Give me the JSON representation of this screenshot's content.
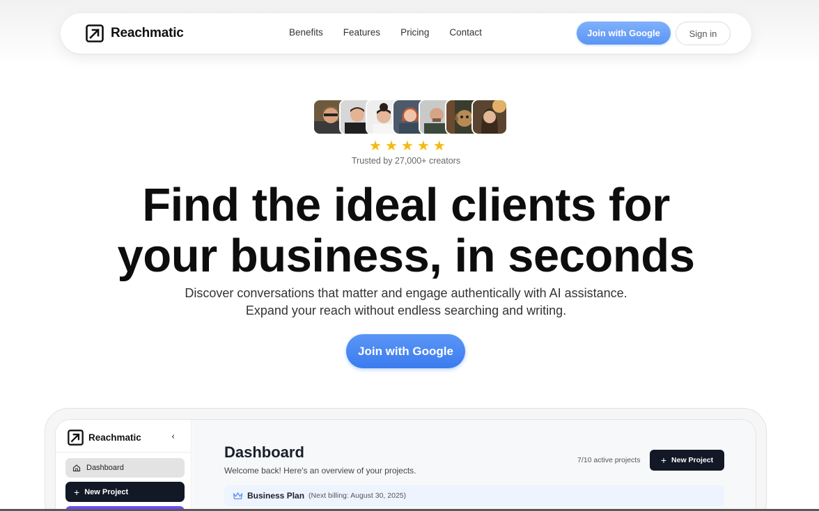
{
  "colors": {
    "accent_blue": "#3b7bee",
    "accent_blue_light": "#7fb0fb",
    "dark": "#121826",
    "star": "#f6b90c",
    "purple": "#6a4cf0"
  },
  "navbar": {
    "logo_icon": "arrow-box-icon",
    "brand": "Reachmatic",
    "links": [
      "Benefits",
      "Features",
      "Pricing",
      "Contact"
    ],
    "join_label": "Join with Google",
    "signin_label": "Sign in"
  },
  "social_proof": {
    "avatar_count": 7,
    "rating": 5,
    "rating_max": 5,
    "trusted_text": "Trusted by 27,000+ creators"
  },
  "hero": {
    "title_line1": "Find the ideal clients for",
    "title_line2": "your business, in seconds",
    "subtitle_line1": "Discover conversations that matter and engage authentically with AI assistance.",
    "subtitle_line2": "Expand your reach without endless searching and writing.",
    "cta_label": "Join with Google"
  },
  "preview": {
    "sidebar": {
      "brand": "Reachmatic",
      "collapse_icon": "chevron-left-icon",
      "items": [
        {
          "label": "Dashboard",
          "icon": "home-icon"
        },
        {
          "label": "New Project",
          "icon": "plus-icon"
        }
      ]
    },
    "main": {
      "title": "Dashboard",
      "subtitle": "Welcome back! Here's an overview of your projects.",
      "active_projects": "7/10 active projects",
      "new_project_label": "New Project",
      "plan_icon": "crown-icon",
      "plan_name": "Business Plan",
      "plan_billing": "(Next billing: August 30, 2025)"
    }
  }
}
